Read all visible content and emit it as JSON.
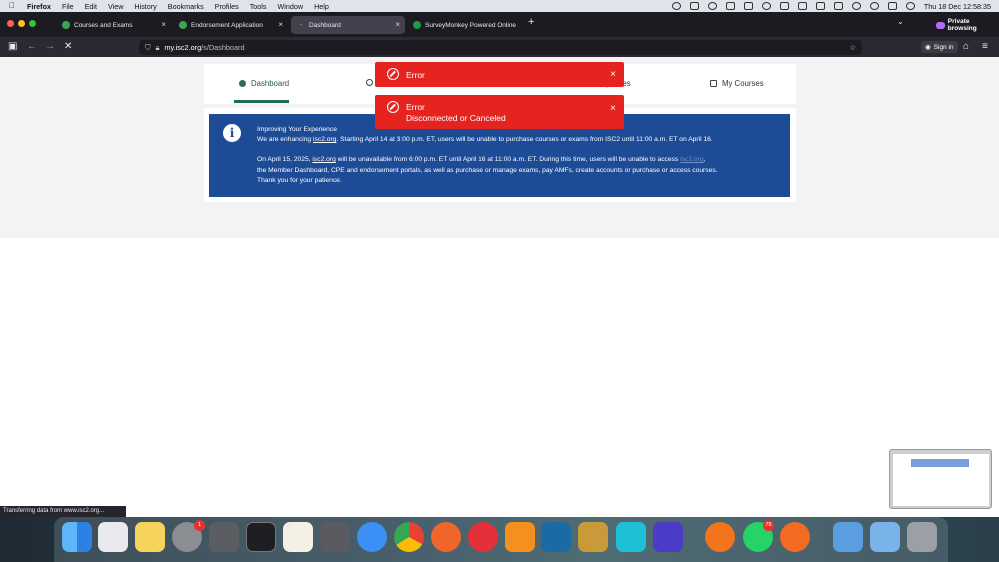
{
  "menubar": {
    "app": "Firefox",
    "items": [
      "File",
      "Edit",
      "View",
      "History",
      "Bookmarks",
      "Profiles",
      "Tools",
      "Window",
      "Help"
    ],
    "clock": "Thu 18 Dec 12:58:35"
  },
  "tabs": [
    {
      "title": "Courses and Exams",
      "active": false,
      "color": "#3aa655"
    },
    {
      "title": "Endorsement Application",
      "active": false,
      "color": "#3aa655"
    },
    {
      "title": "Dashboard",
      "active": true,
      "color": "#888888"
    },
    {
      "title": "SurveyMonkey Powered Online",
      "active": false,
      "color": "#1e9c4a"
    }
  ],
  "private_label": "Private browsing",
  "url": {
    "host": "my.isc2.org",
    "path": "/s/Dashboard"
  },
  "signin_label": "Sign in",
  "nav": {
    "dashboard": "Dashboard",
    "dues": "ship Dues",
    "courses": "My Courses"
  },
  "banner": {
    "title": "Improving Your Experience",
    "p1_a": "We are enhancing ",
    "p1_link": "isc2.org",
    "p1_b": ". Starting April 14 at 3:00 p.m. ET, users will be unable to purchase courses or exams from ISC2 until 11:00 a.m. ET on April 16.",
    "p2_a": "On April 15, 2025, ",
    "p2_link": "isc2.org",
    "p2_b": " will be unavailable from 6:00 p.m. ET until April 16 at 11:00 a.m. ET. During this time, users will be unable to access ",
    "p2_link2": "isc2.org",
    "p2_c": ",",
    "p2_line2": "the Member Dashboard, CPE and endorsement portals, as well as purchase or manage exams, pay AMFs, create accounts or purchase or access courses.",
    "p2_line3": "Thank you for your patience."
  },
  "toasts": [
    {
      "title": "Error",
      "message": ""
    },
    {
      "title": "Error",
      "message": "Disconnected or Canceled"
    }
  ],
  "status_text": "Transferring data from www.isc2.org...",
  "dock_badges": {
    "settings": "1",
    "whatsapp": "78"
  },
  "colors": {
    "accent": "#1e6a55",
    "banner": "#1d4b96",
    "error": "#e52420"
  }
}
